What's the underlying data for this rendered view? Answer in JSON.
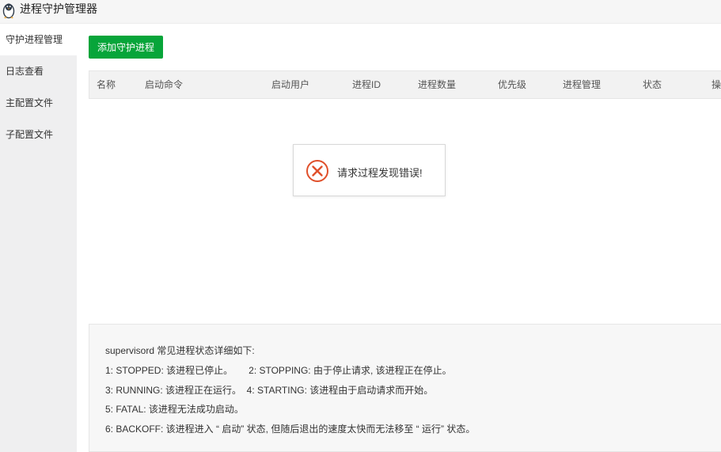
{
  "titlebar": {
    "title": "进程守护管理器",
    "icon": "penguin-icon"
  },
  "sidebar": {
    "items": [
      {
        "label": "守护进程管理",
        "active": true
      },
      {
        "label": "日志查看",
        "active": false
      },
      {
        "label": "主配置文件",
        "active": false
      },
      {
        "label": "子配置文件",
        "active": false
      }
    ]
  },
  "toolbar": {
    "add_label": "添加守护进程",
    "add_color": "#07a53a"
  },
  "table": {
    "columns": [
      "名称",
      "启动命令",
      "启动用户",
      "进程ID",
      "进程数量",
      "优先级",
      "进程管理",
      "状态",
      "操作"
    ]
  },
  "toast": {
    "message": "请求过程发现错误!",
    "icon": "error-icon",
    "color": "#e0502b"
  },
  "info": {
    "heading": "supervisord 常见进程状态详细如下:",
    "lines": [
      "1: STOPPED: 该进程已停止。      2: STOPPING: 由于停止请求, 该进程正在停止。",
      "3: RUNNING: 该进程正在运行。  4: STARTING: 该进程由于启动请求而开始。",
      "5: FATAL: 该进程无法成功启动。",
      "6: BACKOFF: 该进程进入 “ 启动” 状态, 但随后退出的速度太快而无法移至 “ 运行” 状态。"
    ]
  }
}
